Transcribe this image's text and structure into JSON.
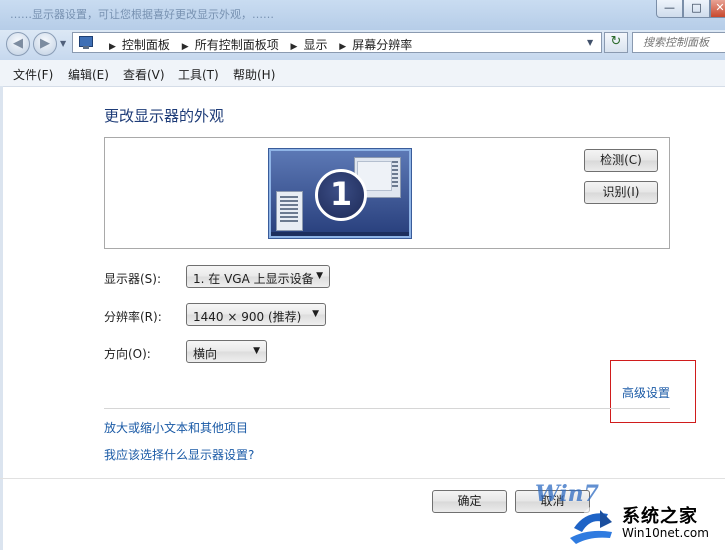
{
  "window": {
    "title_faded": "……显示器设置，可让您根据喜好更改显示外观，……"
  },
  "nav": {
    "breadcrumbs": [
      "控制面板",
      "所有控制面板项",
      "显示",
      "屏幕分辨率"
    ],
    "search_placeholder": "搜索控制面板"
  },
  "menu": {
    "items": [
      "文件(F)",
      "编辑(E)",
      "查看(V)",
      "工具(T)",
      "帮助(H)"
    ]
  },
  "content": {
    "heading": "更改显示器的外观",
    "monitor_number": "1",
    "detect_button": "检测(C)",
    "identify_button": "识别(I)",
    "display_label": "显示器(S):",
    "display_value": "1. 在 VGA 上显示设备",
    "resolution_label": "分辨率(R):",
    "resolution_value": "1440 × 900 (推荐)",
    "orientation_label": "方向(O):",
    "orientation_value": "横向",
    "advanced_link": "高级设置",
    "text_size_link": "放大或缩小文本和其他项目",
    "which_settings_link": "我应该选择什么显示器设置?",
    "ok_button": "确定",
    "cancel_button": "取消"
  },
  "watermark": {
    "brand": "Win7",
    "site_name": "系统之家",
    "url": "Win10net.com"
  },
  "colors": {
    "link": "#1a5aa6",
    "heading": "#1e3c78",
    "highlight_box": "#d01c1c"
  }
}
